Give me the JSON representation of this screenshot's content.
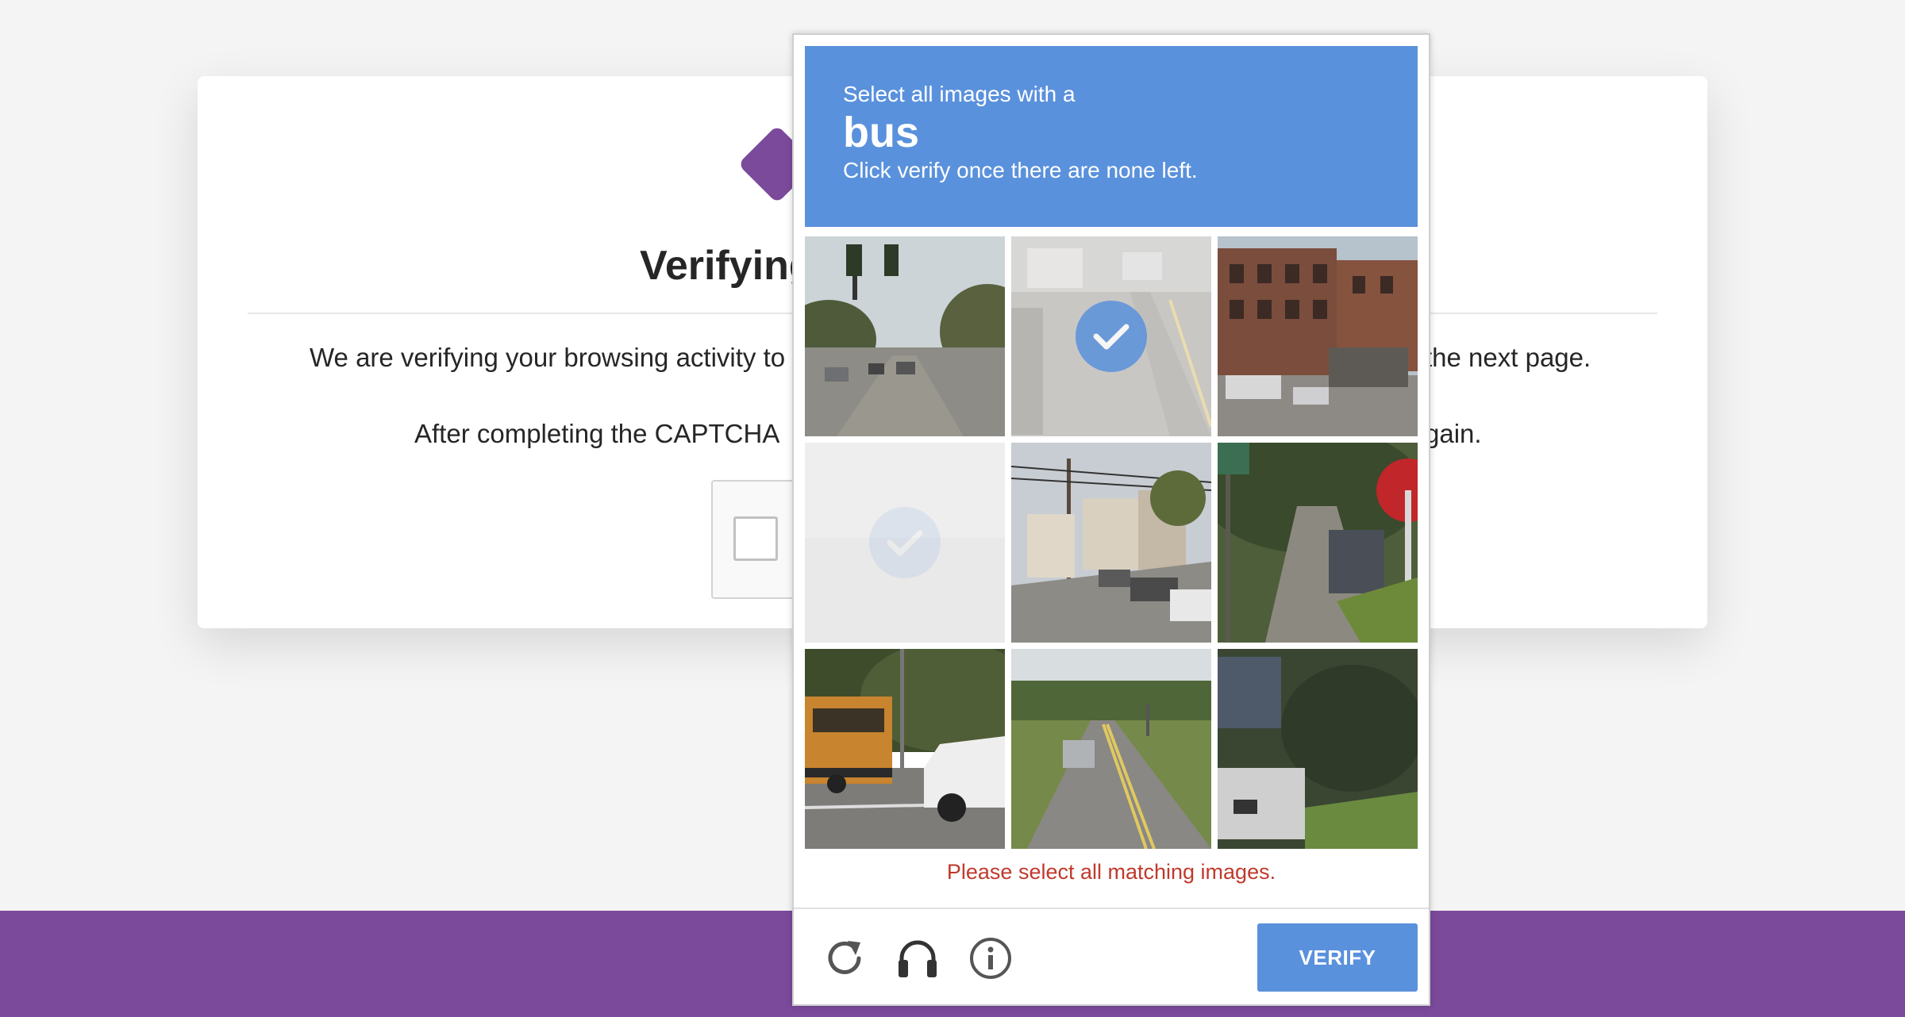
{
  "page": {
    "title": "Verifying",
    "paragraph1_left": "We are verifying your browsing activity to",
    "paragraph1_right": "the next page.",
    "paragraph2_left": "After completing the CAPTCHA",
    "paragraph2_right": "gain."
  },
  "challenge": {
    "instruction_line1": "Select all images with a",
    "keyword": "bus",
    "instruction_line3": "Click verify once there are none left.",
    "error_message": "Please select all matching images.",
    "verify_label": "VERIFY",
    "tiles": [
      {
        "scene": "street-traffic-lights",
        "state": "normal"
      },
      {
        "scene": "road-trucks",
        "state": "selected"
      },
      {
        "scene": "brick-buildings",
        "state": "normal"
      },
      {
        "scene": "faded-tile",
        "state": "fading"
      },
      {
        "scene": "houses-street",
        "state": "normal"
      },
      {
        "scene": "sidewalk-stop-sign",
        "state": "normal"
      },
      {
        "scene": "school-bus",
        "state": "normal"
      },
      {
        "scene": "rural-road",
        "state": "normal"
      },
      {
        "scene": "parked-truck",
        "state": "normal"
      }
    ],
    "icons": [
      "reload-icon",
      "audio-icon",
      "info-icon"
    ]
  },
  "colors": {
    "accent": "#5a91dc",
    "brand": "#7b4a9b",
    "error": "#c0392b"
  }
}
